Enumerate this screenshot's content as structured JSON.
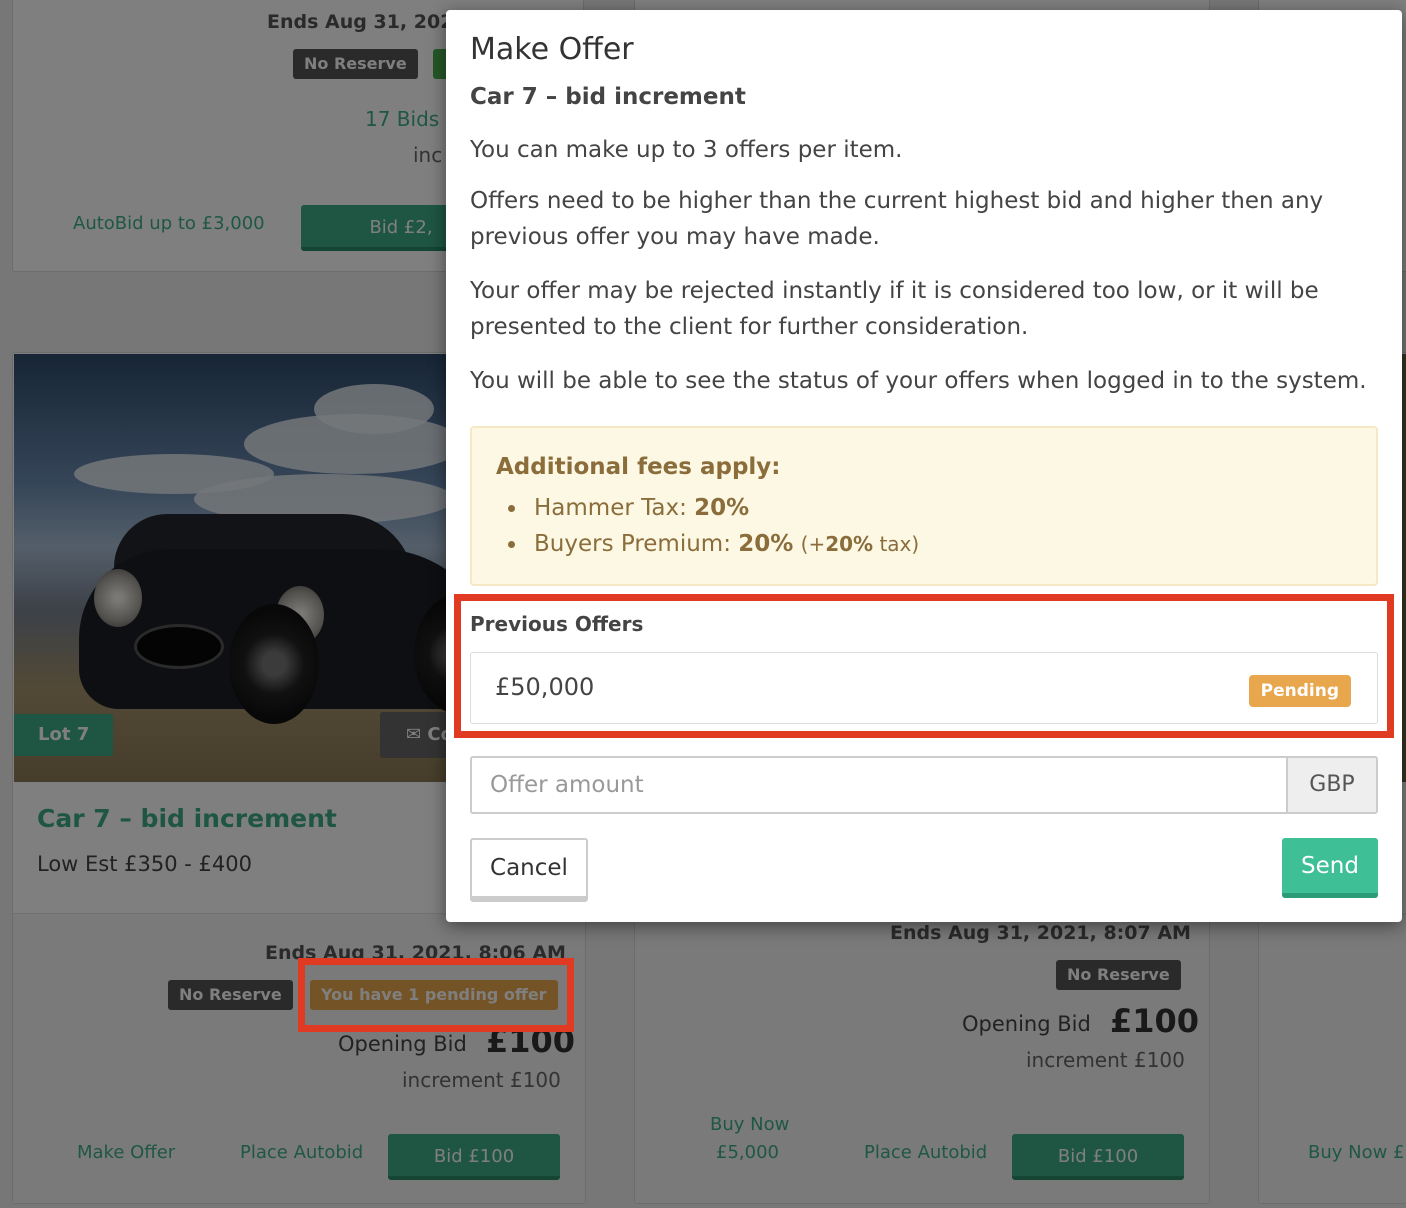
{
  "background": {
    "top_card": {
      "end_date": "Ends Aug 31, 202",
      "no_reserve": "No Reserve",
      "bids": "17 Bids",
      "increment_partial": "inc",
      "autobid": "AutoBid up to £3,000",
      "bid_button": "Bid £2,"
    },
    "car7_card": {
      "lot": "Lot 7",
      "contact_label": "Co",
      "title": "Car 7 – bid increment",
      "estimate": "Low Est £350 - £400",
      "end_date": "Ends Aug 31, 2021, 8:06 AM",
      "no_reserve": "No Reserve",
      "pending_offer": "You have 1 pending offer",
      "opening_bid_label": "Opening Bid",
      "opening_bid_value": "£100",
      "increment": "increment £100",
      "make_offer": "Make Offer",
      "place_autobid": "Place Autobid",
      "bid_button": "Bid £100"
    },
    "middle_card": {
      "end_date": "Ends Aug 31, 2021, 8:07 AM",
      "no_reserve": "No Reserve",
      "opening_bid_label": "Opening Bid",
      "opening_bid_value": "£100",
      "increment": "increment £100",
      "buy_now_label": "Buy Now",
      "buy_now_value": "£5,000",
      "place_autobid": "Place Autobid",
      "bid_button": "Bid £100"
    },
    "right_card": {
      "buy_now": "Buy Now £"
    }
  },
  "modal": {
    "title": "Make Offer",
    "subtitle": "Car 7 – bid increment",
    "para1": "You can make up to 3 offers per item.",
    "para2": "Offers need to be higher than the current highest bid and higher then any previous offer you may have made.",
    "para3": "Your offer may be rejected instantly if it is considered too low, or it will be presented to the client for further consideration.",
    "para4": "You will be able to see the status of your offers when logged in to the system.",
    "fees": {
      "title": "Additional fees apply:",
      "hammer_label": "Hammer Tax:",
      "hammer_value": "20%",
      "premium_label": "Buyers Premium:",
      "premium_value": "20%",
      "premium_tax_prefix": "(+",
      "premium_tax_value": "20%",
      "premium_tax_suffix": " tax)"
    },
    "previous_offers_label": "Previous Offers",
    "previous_offer_amount": "£50,000",
    "previous_offer_status": "Pending",
    "offer_placeholder": "Offer amount",
    "currency": "GBP",
    "cancel": "Cancel",
    "send": "Send"
  },
  "colors": {
    "accent_green": "#3cad86",
    "pending_orange": "#e8a64d",
    "highlight_red": "#e13a22",
    "warning_bg": "#fcf8e3"
  }
}
